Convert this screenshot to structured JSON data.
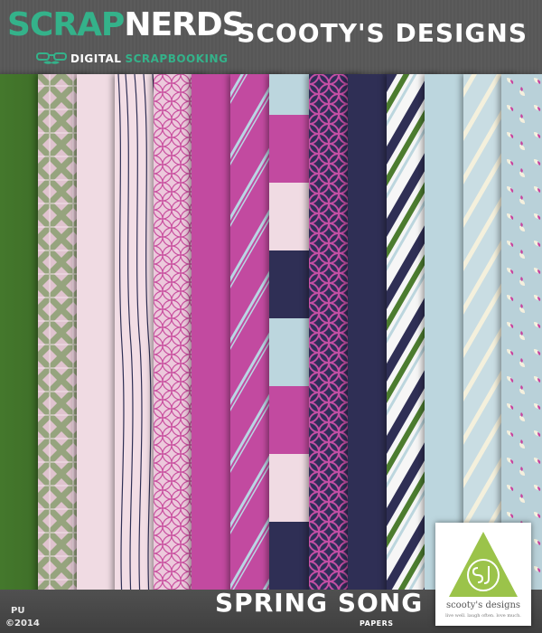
{
  "header": {
    "brand_part1": "SCRAP",
    "brand_part2": "NERDS",
    "tagline_part1": "DIGITAL",
    "tagline_part2": "SCRAPBOOKING",
    "designer": "SCOOTY'S DESIGNS"
  },
  "footer": {
    "pu_label": "PU",
    "copyright": "©2014",
    "kit_title": "SPRING SONG",
    "kit_subtitle": "PAPERS"
  },
  "logo": {
    "name": "scooty's designs",
    "motto": "live well. laugh often. love much."
  },
  "colors": {
    "brand_green": "#34b28a",
    "leaf_green": "#4a7a2e",
    "orchid": "#c0489f",
    "blush": "#f0d8e1",
    "navy": "#2f2f55",
    "sky": "#bcd6de"
  },
  "papers": [
    {
      "name": "solid-green-paper",
      "pattern": "solid"
    },
    {
      "name": "gingham-paper",
      "pattern": "plaid"
    },
    {
      "name": "solid-blush-paper",
      "pattern": "solid"
    },
    {
      "name": "woodgrain-lines-paper",
      "pattern": "wavy-lines"
    },
    {
      "name": "circle-lattice-paper",
      "pattern": "circles"
    },
    {
      "name": "solid-orchid-paper",
      "pattern": "solid"
    },
    {
      "name": "thin-stripe-orchid-paper",
      "pattern": "diagonal-stripes"
    },
    {
      "name": "color-block-paper",
      "pattern": "blocks"
    },
    {
      "name": "navy-lattice-paper",
      "pattern": "circles"
    },
    {
      "name": "solid-navy-paper",
      "pattern": "solid"
    },
    {
      "name": "bold-stripe-paper",
      "pattern": "diagonal-stripes"
    },
    {
      "name": "solid-sky-paper",
      "pattern": "solid"
    },
    {
      "name": "sky-stripe-paper",
      "pattern": "diagonal-stripes"
    },
    {
      "name": "petal-print-paper",
      "pattern": "petals"
    }
  ]
}
